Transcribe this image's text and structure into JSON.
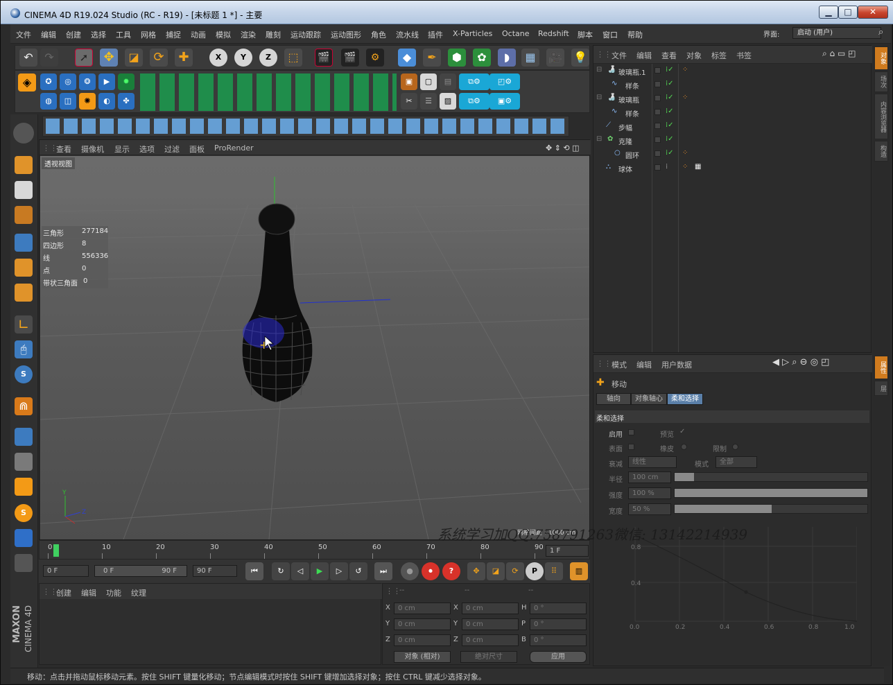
{
  "window": {
    "title": "CINEMA 4D R19.024 Studio (RC - R19) - [未标题 1 *] - 主要",
    "btn_min": "▁",
    "btn_max": "□",
    "btn_close": "✕"
  },
  "menu": {
    "items": [
      "文件",
      "编辑",
      "创建",
      "选择",
      "工具",
      "网格",
      "捕捉",
      "动画",
      "模拟",
      "渲染",
      "雕刻",
      "运动跟踪",
      "运动图形",
      "角色",
      "流水线",
      "插件",
      "X-Particles",
      "Octane",
      "Redshift",
      "脚本",
      "窗口",
      "帮助"
    ],
    "layout_label": "界面:",
    "layout_value": "启动 (用户)"
  },
  "viewport": {
    "menu": [
      "查看",
      "摄像机",
      "显示",
      "选项",
      "过滤",
      "面板",
      "ProRender"
    ],
    "label": "透视视图",
    "stats": [
      {
        "k": "三角形",
        "v": "277184"
      },
      {
        "k": "四边形",
        "v": "8"
      },
      {
        "k": "线",
        "v": "556336"
      },
      {
        "k": "点",
        "v": "0"
      },
      {
        "k": "带状三角面",
        "v": "0"
      }
    ],
    "grid_spacing": "网格间距 : 1000 cm"
  },
  "timeline": {
    "ticks": [
      "0",
      "10",
      "20",
      "30",
      "40",
      "50",
      "60",
      "70",
      "80",
      "90"
    ],
    "current": "1 F",
    "playhead_frame": 1,
    "max_frame": 90
  },
  "controls": {
    "start": "0 F",
    "range_start": "0 F",
    "range_end": "90 F",
    "end": "90 F"
  },
  "material_panel": {
    "menu": [
      "创建",
      "编辑",
      "功能",
      "纹理"
    ]
  },
  "coords": {
    "header": [
      "--",
      "--",
      "--"
    ],
    "rows": [
      {
        "a": "X",
        "av": "0 cm",
        "b": "X",
        "bv": "0 cm",
        "c": "H",
        "cv": "0 °"
      },
      {
        "a": "Y",
        "av": "0 cm",
        "b": "Y",
        "bv": "0 cm",
        "c": "P",
        "cv": "0 °"
      },
      {
        "a": "Z",
        "av": "0 cm",
        "b": "Z",
        "bv": "0 cm",
        "c": "B",
        "cv": "0 °"
      }
    ],
    "mode": "对象 (相对)",
    "size_mode": "绝对尺寸",
    "apply": "应用"
  },
  "object_manager": {
    "menu": [
      "文件",
      "编辑",
      "查看",
      "对象",
      "标签",
      "书签"
    ],
    "objects": [
      {
        "name": "玻璃瓶.1",
        "indent": 0
      },
      {
        "name": "样条",
        "indent": 1
      },
      {
        "name": "玻璃瓶",
        "indent": 0
      },
      {
        "name": "样条",
        "indent": 1
      },
      {
        "name": "步幅",
        "indent": 0
      },
      {
        "name": "克隆",
        "indent": 0
      },
      {
        "name": "圆环",
        "indent": 1
      },
      {
        "name": "球体",
        "indent": 0
      }
    ]
  },
  "attributes": {
    "menu": [
      "模式",
      "编辑",
      "用户数据"
    ],
    "tool": "移动",
    "tabs": [
      "轴向",
      "对象轴心",
      "柔和选择"
    ],
    "active_tab": "柔和选择",
    "section": "柔和选择",
    "enable": "启用",
    "preview": "预览",
    "surface": "表面",
    "rubber": "橡皮",
    "limit": "限制",
    "falloff_label": "衰减",
    "falloff_value": "线性",
    "mode_label": "模式",
    "mode_value": "全部",
    "radius_label": "半径",
    "radius_value": "100 cm",
    "strength_label": "强度",
    "strength_value": "100 %",
    "width_label": "宽度",
    "width_value": "50 %",
    "graph_y": [
      "0.8",
      "0.4"
    ],
    "graph_x": [
      "0.0",
      "0.2",
      "0.4",
      "0.6",
      "0.8",
      "1.0"
    ]
  },
  "right_tabs": [
    "对象",
    "场次",
    "内容浏览器",
    "构造",
    "属性",
    "层"
  ],
  "status": "移动：点击并拖动鼠标移动元素。按住 SHIFT 键量化移动；节点编辑模式时按住 SHIFT 键增加选择对象；按住 CTRL 键减少选择对象。",
  "brand": {
    "a": "MAXON",
    "b": "CINEMA 4D"
  },
  "watermark": "系统学习加QQ:758791263微信: 13142214939"
}
